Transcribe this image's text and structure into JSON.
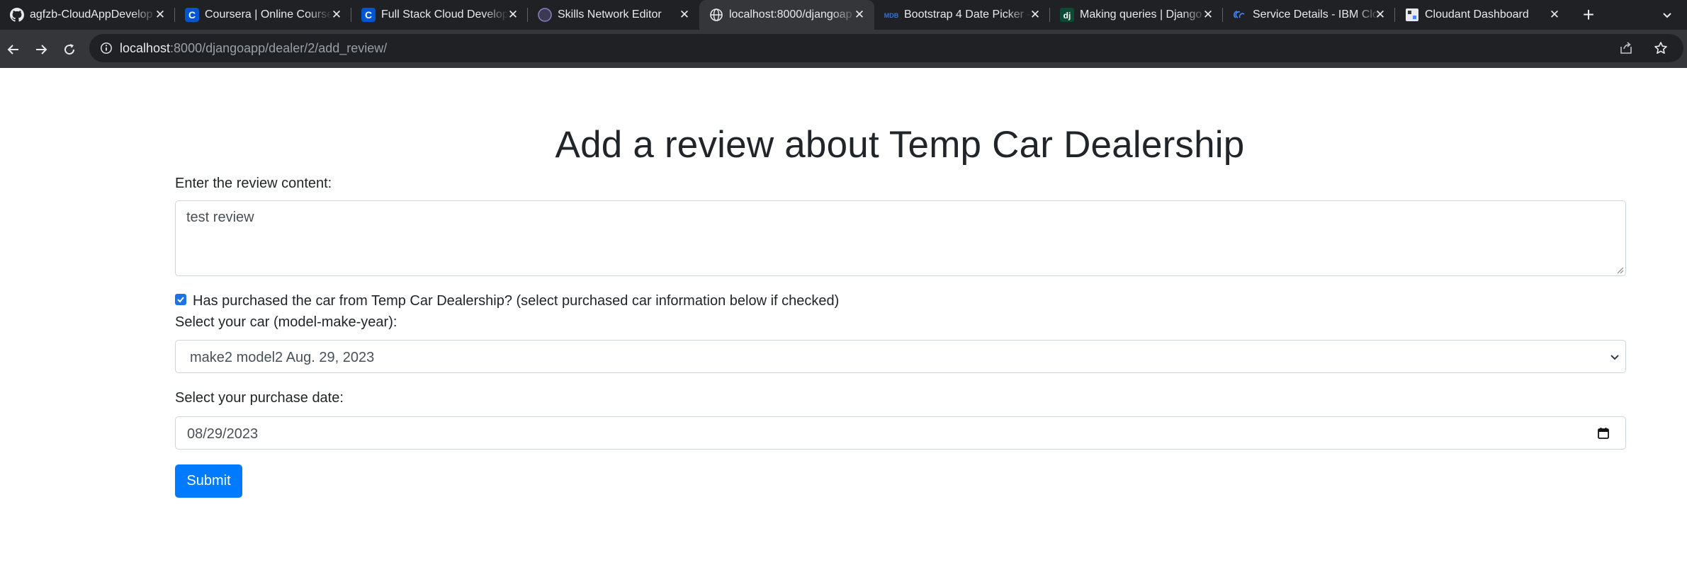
{
  "browser": {
    "tabs": [
      {
        "title": "agfzb-CloudAppDevelop",
        "icon": "github-icon",
        "active": false
      },
      {
        "title": "Coursera | Online Course",
        "icon": "coursera-icon",
        "active": false
      },
      {
        "title": "Full Stack Cloud Develop",
        "icon": "coursera-icon",
        "active": false
      },
      {
        "title": "Skills Network Editor",
        "icon": "skills-network-icon",
        "active": false
      },
      {
        "title": "localhost:8000/djangoap",
        "icon": "globe-icon",
        "active": true
      },
      {
        "title": "Bootstrap 4 Date Picker -",
        "icon": "mdb-icon",
        "active": false
      },
      {
        "title": "Making queries | Django",
        "icon": "django-icon",
        "active": false
      },
      {
        "title": "Service Details - IBM Clo",
        "icon": "ibm-cloud-icon",
        "active": false
      },
      {
        "title": "Cloudant Dashboard",
        "icon": "cloudant-icon",
        "active": false
      }
    ],
    "url": {
      "host": "localhost",
      "rest": ":8000/djangoapp/dealer/2/add_review/"
    }
  },
  "page": {
    "title": "Add a review about Temp Car Dealership",
    "review_label": "Enter the review content:",
    "review_value": "test review",
    "purchase_check_label": "Has purchased the car from Temp Car Dealership? (select purchased car information below if checked)",
    "purchase_checked": true,
    "car_label": "Select your car (model-make-year):",
    "car_selected": "make2 model2 Aug. 29, 2023",
    "date_label": "Select your purchase date:",
    "date_value": "08/29/2023",
    "submit_label": "Submit"
  },
  "colors": {
    "primary": "#007bff",
    "text": "#212529",
    "chrome_dark": "#202124",
    "chrome_active": "#35363a"
  }
}
